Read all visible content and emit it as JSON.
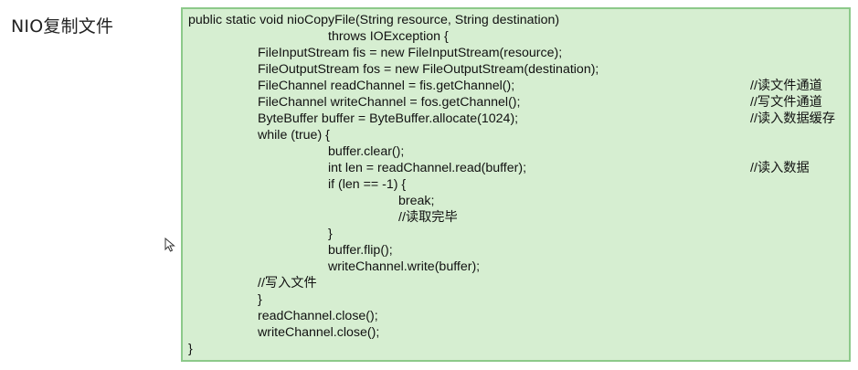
{
  "title": "NIO复制文件",
  "code": {
    "lines": [
      "public static void nioCopyFile(String resource, String destination)",
      "throws IOException {",
      "FileInputStream fis = new FileInputStream(resource);",
      "FileOutputStream fos = new FileOutputStream(destination);",
      "FileChannel readChannel = fis.getChannel();",
      "FileChannel writeChannel = fos.getChannel();",
      "ByteBuffer buffer = ByteBuffer.allocate(1024);",
      "while (true) {",
      "buffer.clear();",
      "int len = readChannel.read(buffer);",
      "if (len == -1) {",
      "break;",
      "//读取完毕",
      "}",
      "buffer.flip();",
      "writeChannel.write(buffer);",
      "//写入文件",
      "}",
      "readChannel.close();",
      "writeChannel.close();",
      "}"
    ],
    "comments": {
      "read_channel": "//读文件通道",
      "write_channel": "//写文件通道",
      "buffer": "//读入数据缓存",
      "read": "//读入数据"
    }
  }
}
